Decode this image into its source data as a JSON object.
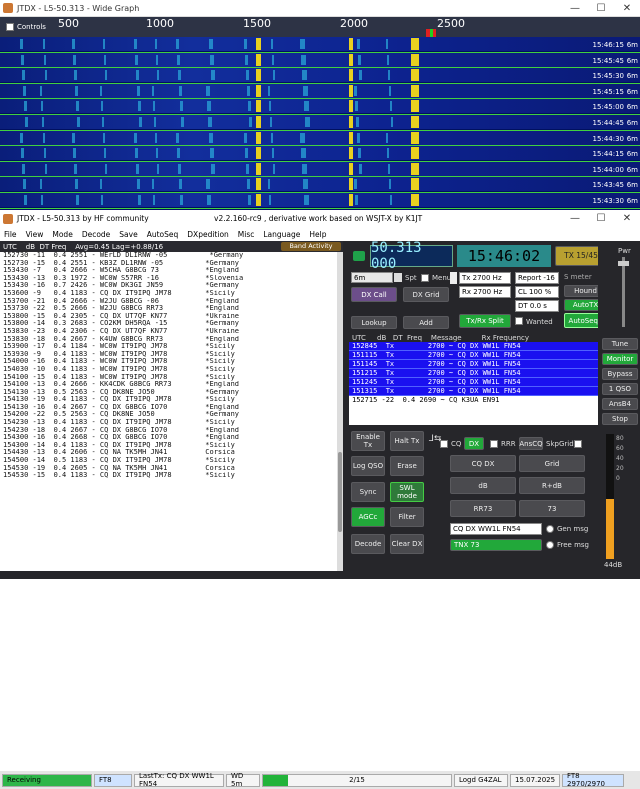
{
  "wide_graph": {
    "title": "JTDX - L5-50.313 - Wide Graph",
    "controls_label": "Controls",
    "ruler": [
      "500",
      "1000",
      "1500",
      "2000",
      "2500"
    ],
    "strips": [
      {
        "time": "15:46:15",
        "band": "6m"
      },
      {
        "time": "15:45:45",
        "band": "6m"
      },
      {
        "time": "15:45:30",
        "band": "6m"
      },
      {
        "time": "15:45:15",
        "band": "6m"
      },
      {
        "time": "15:45:00",
        "band": "6m"
      },
      {
        "time": "15:44:45",
        "band": "6m"
      },
      {
        "time": "15:44:30",
        "band": "6m"
      },
      {
        "time": "15:44:15",
        "band": "6m"
      },
      {
        "time": "15:44:00",
        "band": "6m"
      },
      {
        "time": "15:43:45",
        "band": "6m"
      },
      {
        "time": "15:43:30",
        "band": "6m"
      }
    ]
  },
  "main": {
    "title": "JTDX - L5-50.313  by HF community",
    "subtitle": "v2.2.160-rc9 , derivative work based on WSJT-X by K1JT",
    "menu": [
      "File",
      "View",
      "Mode",
      "Decode",
      "Save",
      "AutoSeq",
      "DXpedition",
      "Misc",
      "Language",
      "Help"
    ],
    "header": "UTC    dB  DT Freq    Avg=0.45 Lag=+0.88/16",
    "band_activity": "Band Activity",
    "rows": [
      "152730 -11  0.4 2551 - WErLD DLIRNW -05          *Germany",
      "152730 -15  0.4 2551 - KB3Z DL1RNW -05          *Germany",
      "153430 -7   0.4 2666 - W5CHA G8BCG 73           *England",
      "153430 -13  0.3 1972 - WC0W S57RR -16           *Slovenia",
      "153430 -16  0.7 2426 - WC0W DK3GI JN59          *Germany",
      "153600 -9   0.4 1183 - CQ DX IT9IPQ JM78        *Sicily",
      "153700 -21  0.4 2666 - W2JU G8BCG -06           *England",
      "153730 -22  0.5 2666 - W2JU G8BCG RR73          *England",
      "153800 -15  0.4 2305 - CQ DX UT7QF KN77         *Ukraine",
      "153800 -14  0.3 2683 - CO2KM DH5RQA -15         *Germany",
      "153830 -23  0.4 2306 - CQ DX UT7QF KN77         *Ukraine",
      "153830 -18  0.4 2667 - K4UW G8BCG RR73          *England",
      "153900 -17  0.4 1184 - WC0W IT9IPQ JM78         *Sicily",
      "153930 -9   0.4 1183 - WC0W IT9IPQ JM78         *Sicily",
      "154000 -16  0.4 1183 - WC0W IT9IPQ JM78         *Sicily",
      "154030 -10  0.4 1183 - WC0W IT9IPQ JM78         *Sicily",
      "154100 -15  0.4 1183 - WC0W IT9IPQ JM78         *Sicily",
      "154100 -13  0.4 2666 - KK4CDK G8BCG RR73        *England",
      "154130 -13  0.5 2563 - CQ DK8NE JO50            *Germany",
      "154130 -19  0.4 1183 - CQ DX IT9IPQ JM78        *Sicily",
      "154130 -16  0.4 2667 - CQ DX G8BCG IO70         *England",
      "154200 -22  0.5 2563 - CQ DK8NE JO50            *Germany",
      "154230 -13  0.4 1183 - CQ DX IT9IPQ JM78        *Sicily",
      "154230 -18  0.4 2667 - CQ DX G8BCG IO70         *England",
      "154300 -16  0.4 2668 - CQ DX G8BCG IO70         *England",
      "154300 -14  0.4 1183 - CQ DX IT9IPQ JM78        *Sicily",
      "154430 -13  0.4 2606 - CQ NA TK5MH JN41         Corsica",
      "154500 -14  0.5 1183 - CQ DX IT9IPQ JM78        *Sicily",
      "154530 -19  0.4 2605 - CQ NA TK5MH JN41         Corsica",
      "154530 -15  0.4 1183 - CQ DX IT9IPQ JM78        *Sicily"
    ],
    "freq": "50.313 000",
    "clock": "15:46:02",
    "tx_label": "TX 15/45",
    "band": "6m",
    "spt": "Spt",
    "menu_chk": "Menu",
    "tx_hz": "Tx  2700  Hz",
    "rx_hz": "Rx  2700  Hz",
    "report": "Report -16",
    "cl": "CL  100 %",
    "dt": "DT 0.0 s",
    "s_meter": "S meter",
    "hound": "Hound",
    "autotx": "AutoTX",
    "txrx_split": "Tx/Rx Split",
    "wanted": "Wanted",
    "autoseq3": "AutoSeq3",
    "dxcall": "DX Call",
    "dxgrid": "DX Grid",
    "lookup": "Lookup",
    "add": "Add",
    "list_hdr": "UTC     dB   DT  Freq    Message         Rx Frequency",
    "list_rows": [
      "152845  Tx        2700 ~ CQ DX WW1L FN54",
      "151115  Tx        2700 ~ CQ DX WW1L FN54",
      "151145  Tx        2700 ~ CQ DX WW1L FN54",
      "151215  Tx        2700 ~ CQ DX WW1L FN54",
      "151245  Tx        2700 ~ CQ DX WW1L FN54",
      "151315  Tx        2700 ~ CQ DX WW1L FN54"
    ],
    "list_last": "152715 -22  0.4 2690 ~ CQ K3UA EN91",
    "buttons": {
      "enable_tx": "Enable Tx",
      "halt_tx": "Halt Tx",
      "log_qso": "Log QSO",
      "erase": "Erase",
      "sync": "Sync",
      "swl": "SWL mode",
      "agcc": "AGCc",
      "filter": "Filter",
      "decode": "Decode",
      "clear_dx": "Clear DX",
      "cq": "CQ",
      "dx": "DX",
      "rrr": "RRR",
      "anscq": "AnsCQ",
      "skpgrid": "SkpGrid",
      "cqdx": "CQ DX",
      "grid": "Grid",
      "db": "dB",
      "rdb": "R+dB",
      "rr73": "RR73",
      "n73": "73",
      "msg_field": "CQ DX WW1L FN54",
      "tnx": "TNX 73",
      "gen_msg": "Gen msg",
      "free_msg": "Free msg",
      "tune": "Tune",
      "monitor": "Monitor",
      "bypass": "Bypass",
      "qso1": "1 QSO",
      "ansb4": "AnsB4",
      "stop": "Stop",
      "pwr": "Pwr",
      "db44": "44dB"
    },
    "status": [
      "Receiving",
      "FT8",
      "LastTx: CQ DX WW1L FN54",
      "WD 5m",
      "2/15",
      "Logd G4ZAL",
      "15.07.2025",
      "FT8  2970/2970"
    ]
  }
}
